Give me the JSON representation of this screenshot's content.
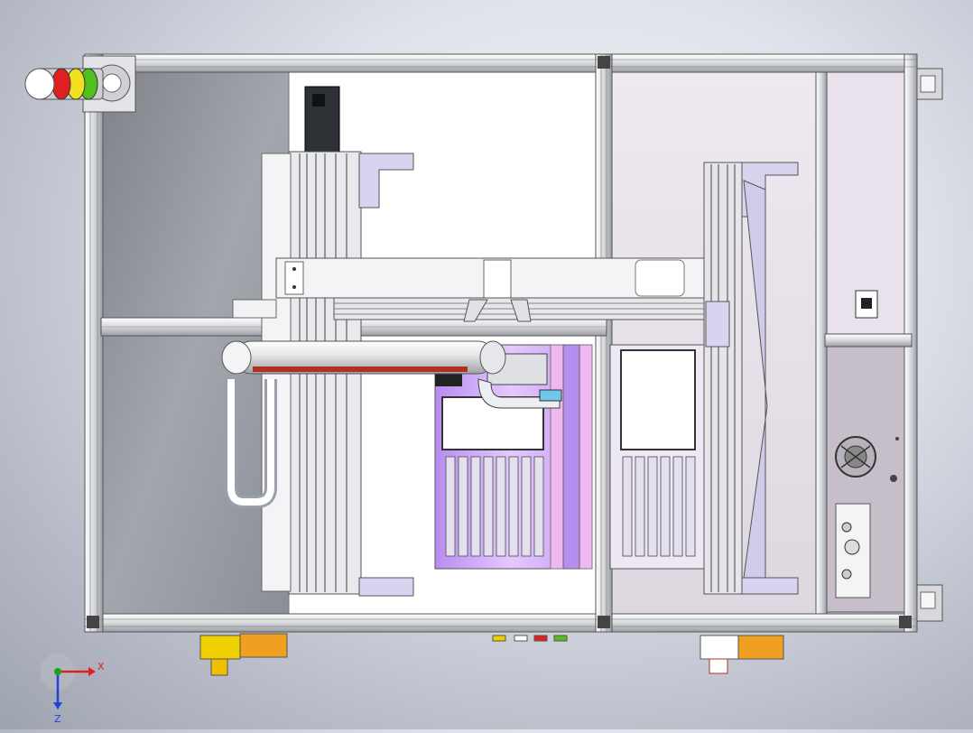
{
  "viewport": {
    "model": "machine-enclosure-assembly",
    "colors": {
      "background": "#c9ccd6",
      "frame": "#e6e7ea",
      "frame_edge": "#555a60",
      "panel_right": "#c9c3cc",
      "panel_left_dark": "#8e9299",
      "tray_purple": "#c9a6f5",
      "tray_pink": "#f0b8f0",
      "accent_red": "#b03020",
      "accent_yellow": "#f0d000",
      "accent_orange": "#f0a020",
      "beacon_red": "#e02020",
      "beacon_yellow": "#f0e020",
      "beacon_green": "#50c020"
    }
  },
  "triad": {
    "x_label": "X",
    "z_label": "Z",
    "x_color": "#e02020",
    "y_color": "#20a020",
    "z_color": "#2040e0"
  }
}
